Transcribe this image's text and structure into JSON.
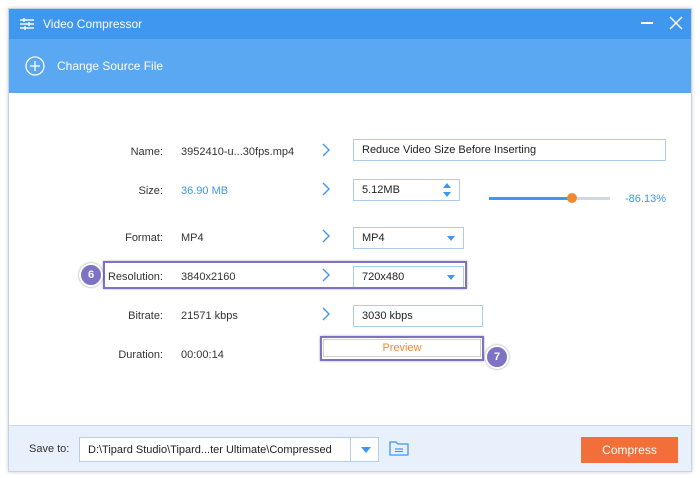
{
  "window": {
    "title": "Video Compressor",
    "icons": [
      "sliders-icon",
      "minimize-icon",
      "close-icon"
    ]
  },
  "toolbar": {
    "change_source_label": "Change Source File",
    "icon": "plus-circle-icon"
  },
  "rows": {
    "name": {
      "label": "Name:",
      "source": "3952410-u...30fps.mp4",
      "target": "Reduce Video Size Before Inserting"
    },
    "size": {
      "label": "Size:",
      "source": "36.90 MB",
      "target": "5.12MB",
      "percent": "-86.13%",
      "slider_level": 0.69
    },
    "format": {
      "label": "Format:",
      "source": "MP4",
      "target": "MP4"
    },
    "resolution": {
      "label": "Resolution:",
      "source": "3840x2160",
      "target": "720x480"
    },
    "bitrate": {
      "label": "Bitrate:",
      "source": "21571 kbps",
      "target": "3030 kbps"
    },
    "duration": {
      "label": "Duration:",
      "source": "00:00:14",
      "preview_label": "Preview"
    }
  },
  "badges": {
    "resolution": "6",
    "preview": "7"
  },
  "bottom": {
    "save_to_label": "Save to:",
    "path": "D:\\Tipard Studio\\Tipard...ter Ultimate\\Compressed",
    "compress_label": "Compress"
  },
  "colors": {
    "titlebar": "#3f97ee",
    "toolbar": "#5aa7f2",
    "accent": "#3f97ee",
    "compress": "#f26f39",
    "highlight": "#7e72c5",
    "preview_text": "#f08a32"
  }
}
